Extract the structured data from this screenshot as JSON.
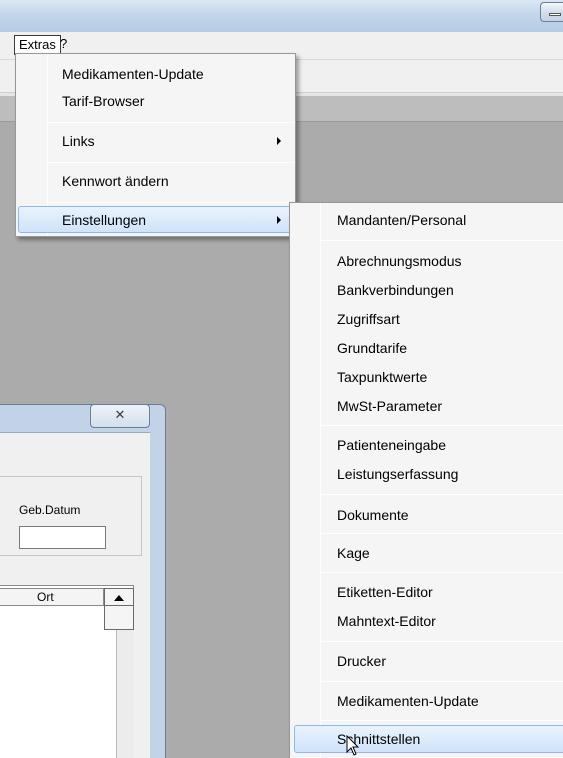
{
  "menubar": {
    "items": [
      {
        "label": "Extras",
        "active": true
      },
      {
        "label": "?",
        "active": false
      }
    ]
  },
  "extras_menu": {
    "items": [
      {
        "label": "Medikamenten-Update",
        "submenu": false
      },
      {
        "label": "Tarif-Browser",
        "submenu": false
      },
      {
        "label": "Links",
        "submenu": true
      },
      {
        "label": "Kennwort ändern",
        "submenu": false
      },
      {
        "label": "Einstellungen",
        "submenu": true,
        "highlighted": true
      }
    ]
  },
  "einstellungen_menu": {
    "items": [
      {
        "label": "Mandanten/Personal"
      },
      {
        "label": "Abrechnungsmodus"
      },
      {
        "label": "Bankverbindungen"
      },
      {
        "label": "Zugriffsart"
      },
      {
        "label": "Grundtarife"
      },
      {
        "label": "Taxpunktwerte"
      },
      {
        "label": "MwSt-Parameter"
      },
      {
        "label": "Patienteneingabe"
      },
      {
        "label": "Leistungserfassung"
      },
      {
        "label": "Dokumente"
      },
      {
        "label": "Kage"
      },
      {
        "label": "Etiketten-Editor"
      },
      {
        "label": "Mahntext-Editor"
      },
      {
        "label": "Drucker"
      },
      {
        "label": "Medikamenten-Update"
      },
      {
        "label": "Schnittstellen",
        "highlighted": true
      }
    ]
  },
  "dialog": {
    "close_glyph": "✕",
    "geb_datum_label": "Geb.Datum",
    "geb_datum_value": "",
    "column_header": "Ort"
  },
  "colors": {
    "menu_highlight_border": "#8fb8e8",
    "menu_highlight_fill": "#cfe3fa",
    "menu_background": "#f5f5f5",
    "app_background": "#ababab"
  },
  "icons": {
    "cursor": "mouse-pointer-icon",
    "submenu": "submenu-arrow-icon",
    "close": "close-icon",
    "scroll_up": "scroll-up-arrow-icon"
  }
}
